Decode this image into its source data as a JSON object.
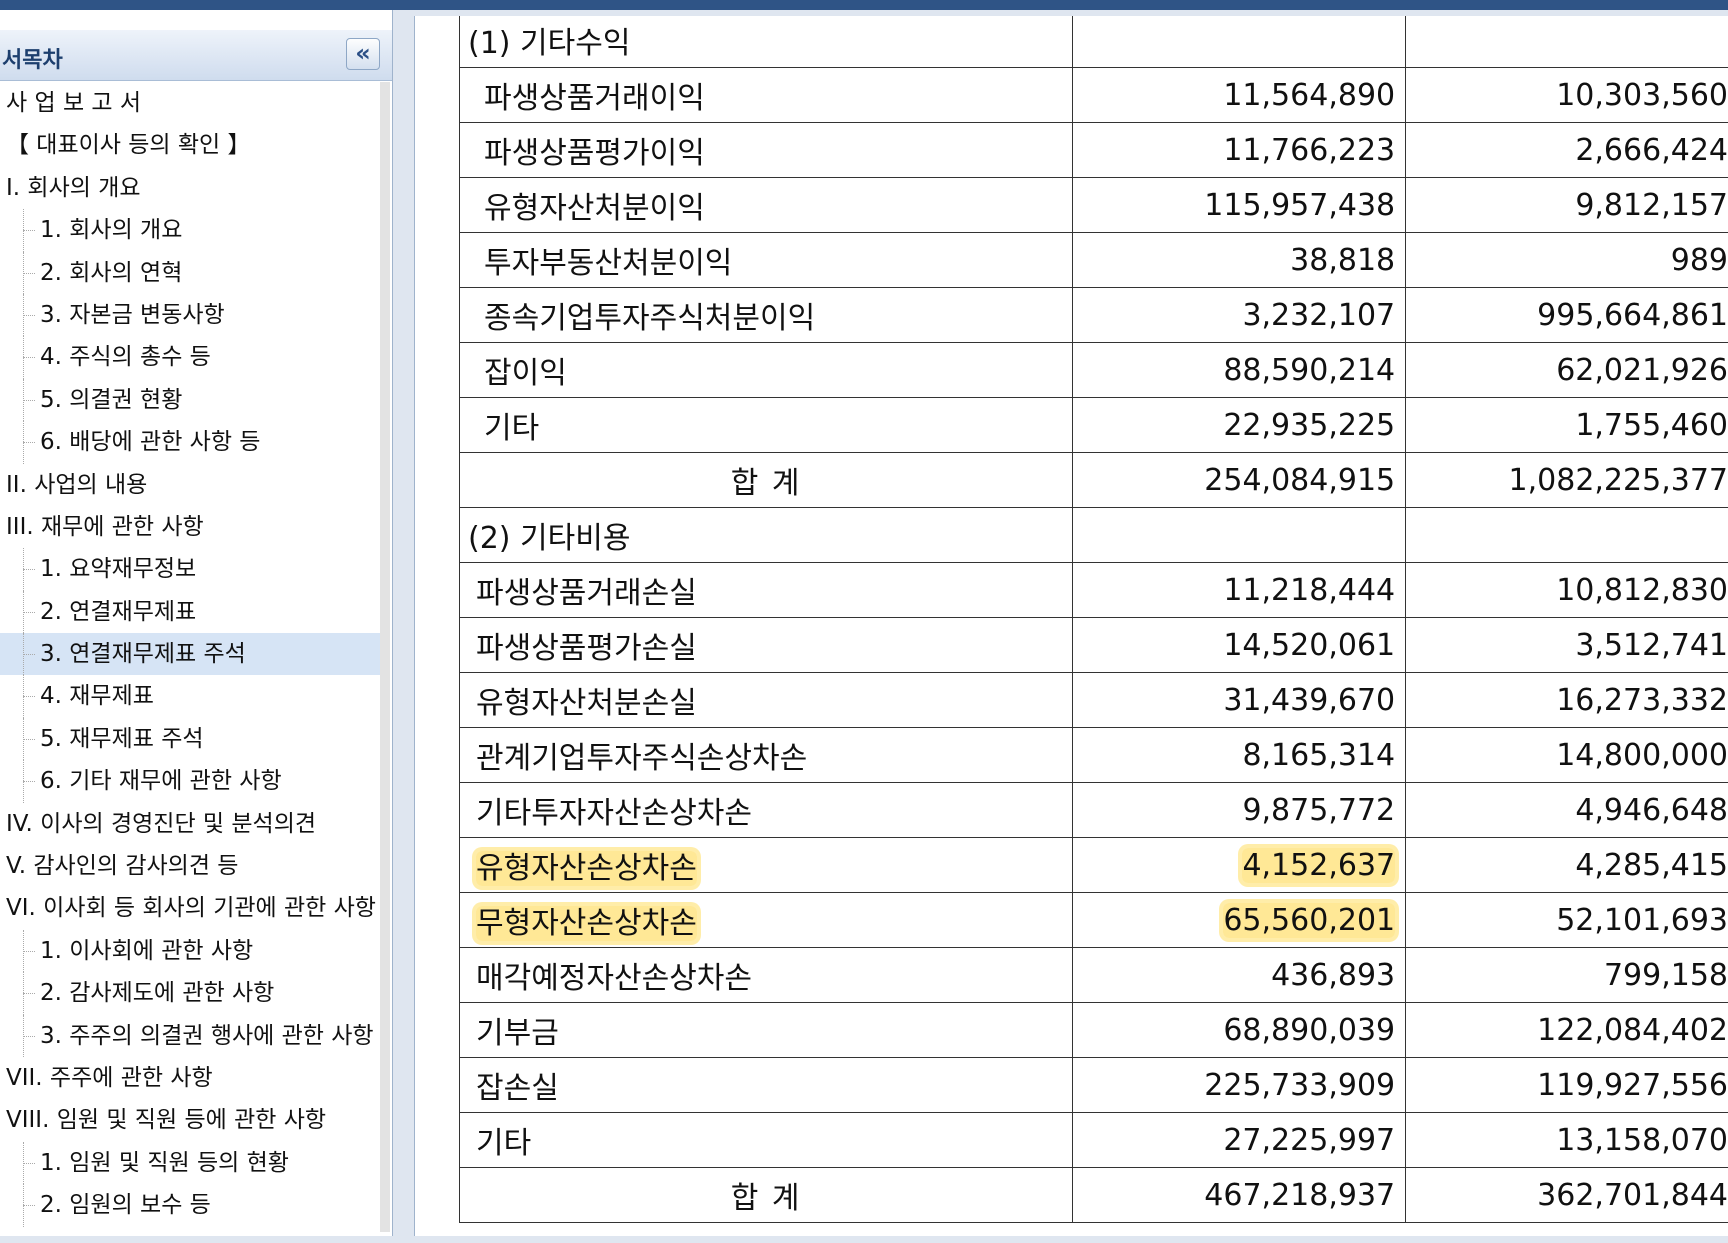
{
  "sidebar": {
    "title": "서목차",
    "collapse_glyph": "«",
    "items": [
      {
        "label": "사 업 보 고 서",
        "level": 0
      },
      {
        "label": "【 대표이사 등의 확인 】",
        "level": 0
      },
      {
        "label": "I. 회사의 개요",
        "level": 0
      },
      {
        "label": "1. 회사의 개요",
        "level": 1
      },
      {
        "label": "2. 회사의 연혁",
        "level": 1
      },
      {
        "label": "3. 자본금 변동사항",
        "level": 1
      },
      {
        "label": "4. 주식의 총수 등",
        "level": 1
      },
      {
        "label": "5. 의결권 현황",
        "level": 1
      },
      {
        "label": "6. 배당에 관한 사항 등",
        "level": 1
      },
      {
        "label": "II. 사업의 내용",
        "level": 0
      },
      {
        "label": "III. 재무에 관한 사항",
        "level": 0
      },
      {
        "label": "1. 요약재무정보",
        "level": 1
      },
      {
        "label": "2. 연결재무제표",
        "level": 1
      },
      {
        "label": "3. 연결재무제표 주석",
        "level": 1,
        "selected": true
      },
      {
        "label": "4. 재무제표",
        "level": 1
      },
      {
        "label": "5. 재무제표 주석",
        "level": 1
      },
      {
        "label": "6. 기타 재무에 관한 사항",
        "level": 1
      },
      {
        "label": "IV. 이사의 경영진단 및 분석의견",
        "level": 0
      },
      {
        "label": "V. 감사인의 감사의견 등",
        "level": 0
      },
      {
        "label": "VI. 이사회 등 회사의 기관에 관한 사항",
        "level": 0
      },
      {
        "label": "1. 이사회에 관한 사항",
        "level": 1
      },
      {
        "label": "2. 감사제도에 관한 사항",
        "level": 1
      },
      {
        "label": "3. 주주의 의결권 행사에 관한 사항",
        "level": 1
      },
      {
        "label": "VII. 주주에 관한 사항",
        "level": 0
      },
      {
        "label": "VIII. 임원 및 직원 등에 관한 사항",
        "level": 0
      },
      {
        "label": "1. 임원 및 직원 등의 현황",
        "level": 1
      },
      {
        "label": "2. 임원의 보수 등",
        "level": 1
      }
    ]
  },
  "table": {
    "rows": [
      {
        "type": "section",
        "label": "(1) 기타수익",
        "cur": "",
        "prev": ""
      },
      {
        "type": "item",
        "indent": "ind",
        "label": "파생상품거래이익",
        "cur": "11,564,890",
        "prev": "10,303,560"
      },
      {
        "type": "item",
        "indent": "ind",
        "label": "파생상품평가이익",
        "cur": "11,766,223",
        "prev": "2,666,424"
      },
      {
        "type": "item",
        "indent": "ind",
        "label": "유형자산처분이익",
        "cur": "115,957,438",
        "prev": "9,812,157"
      },
      {
        "type": "item",
        "indent": "ind",
        "label": "투자부동산처분이익",
        "cur": "38,818",
        "prev": "989"
      },
      {
        "type": "item",
        "indent": "ind",
        "label": "종속기업투자주식처분이익",
        "cur": "3,232,107",
        "prev": "995,664,861"
      },
      {
        "type": "item",
        "indent": "ind",
        "label": "잡이익",
        "cur": "88,590,214",
        "prev": "62,021,926"
      },
      {
        "type": "item",
        "indent": "ind",
        "label": "기타",
        "cur": "22,935,225",
        "prev": "1,755,460"
      },
      {
        "type": "total",
        "label": "합   계",
        "cur": "254,084,915",
        "prev": "1,082,225,377"
      },
      {
        "type": "section",
        "label": "(2) 기타비용",
        "cur": "",
        "prev": ""
      },
      {
        "type": "item",
        "indent": "ind2",
        "label": "파생상품거래손실",
        "cur": "11,218,444",
        "prev": "10,812,830"
      },
      {
        "type": "item",
        "indent": "ind2",
        "label": "파생상품평가손실",
        "cur": "14,520,061",
        "prev": "3,512,741"
      },
      {
        "type": "item",
        "indent": "ind2",
        "label": "유형자산처분손실",
        "cur": "31,439,670",
        "prev": "16,273,332"
      },
      {
        "type": "item",
        "indent": "ind2",
        "label": "관계기업투자주식손상차손",
        "cur": "8,165,314",
        "prev": "14,800,000"
      },
      {
        "type": "item",
        "indent": "ind2",
        "label": "기타투자자산손상차손",
        "cur": "9,875,772",
        "prev": "4,946,648"
      },
      {
        "type": "item",
        "indent": "ind2",
        "label": "유형자산손상차손",
        "cur": "4,152,637",
        "prev": "4,285,415",
        "highlight": true
      },
      {
        "type": "item",
        "indent": "ind2",
        "label": "무형자산손상차손",
        "cur": "65,560,201",
        "prev": "52,101,693",
        "highlight": true
      },
      {
        "type": "item",
        "indent": "ind2",
        "label": "매각예정자산손상차손",
        "cur": "436,893",
        "prev": "799,158"
      },
      {
        "type": "item",
        "indent": "ind2",
        "label": "기부금",
        "cur": "68,890,039",
        "prev": "122,084,402"
      },
      {
        "type": "item",
        "indent": "ind2",
        "label": "잡손실",
        "cur": "225,733,909",
        "prev": "119,927,556"
      },
      {
        "type": "item",
        "indent": "ind2",
        "label": "기타",
        "cur": "27,225,997",
        "prev": "13,158,070"
      },
      {
        "type": "total",
        "label": "합   계",
        "cur": "467,218,937",
        "prev": "362,701,844"
      }
    ],
    "highlight_color": "#ffd640"
  }
}
